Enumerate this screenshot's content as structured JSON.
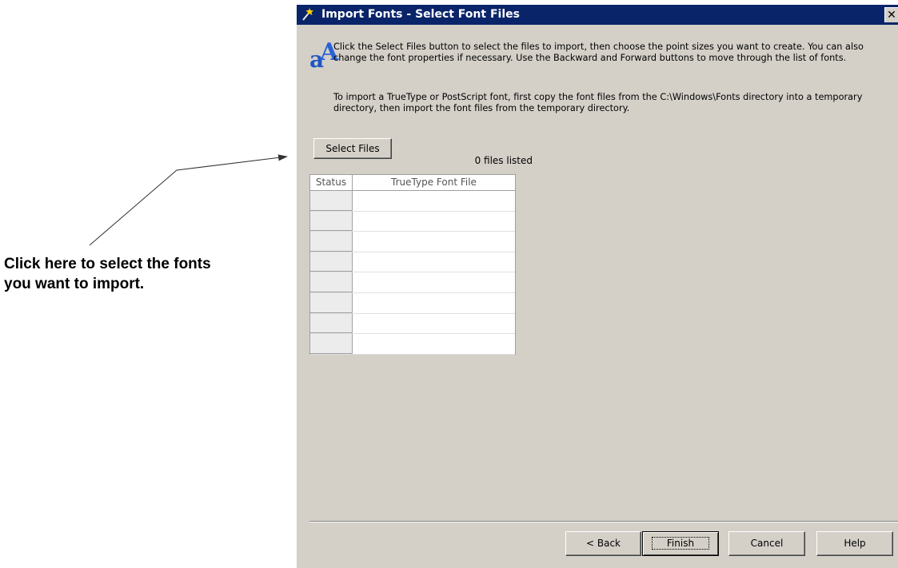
{
  "annotation": {
    "text": "Click here to select the fonts\nyou want to import."
  },
  "dialog": {
    "title": "Import Fonts - Select Font Files",
    "close_label": "✕",
    "instructions": [
      "Click the Select Files button to select the files to import, then choose the point sizes you want to create. You can also change the font properties if necessary. Use the Backward and Forward buttons to move through the list of fonts.",
      "To import a TrueType or PostScript font, first copy the font files from the C:\\Windows\\Fonts directory into a temporary directory, then import the font files from the temporary directory."
    ],
    "select_files_label": "Select Files",
    "files_count": "0 files listed",
    "table": {
      "columns": [
        "Status",
        "TrueType Font File"
      ],
      "rows": []
    },
    "buttons": {
      "back": "< Back",
      "finish": "Finish",
      "cancel": "Cancel",
      "help": "Help"
    }
  },
  "colors": {
    "titlebar": "#0a246a",
    "dialog_bg": "#d4d0c8",
    "logo": "#1f56c4"
  }
}
